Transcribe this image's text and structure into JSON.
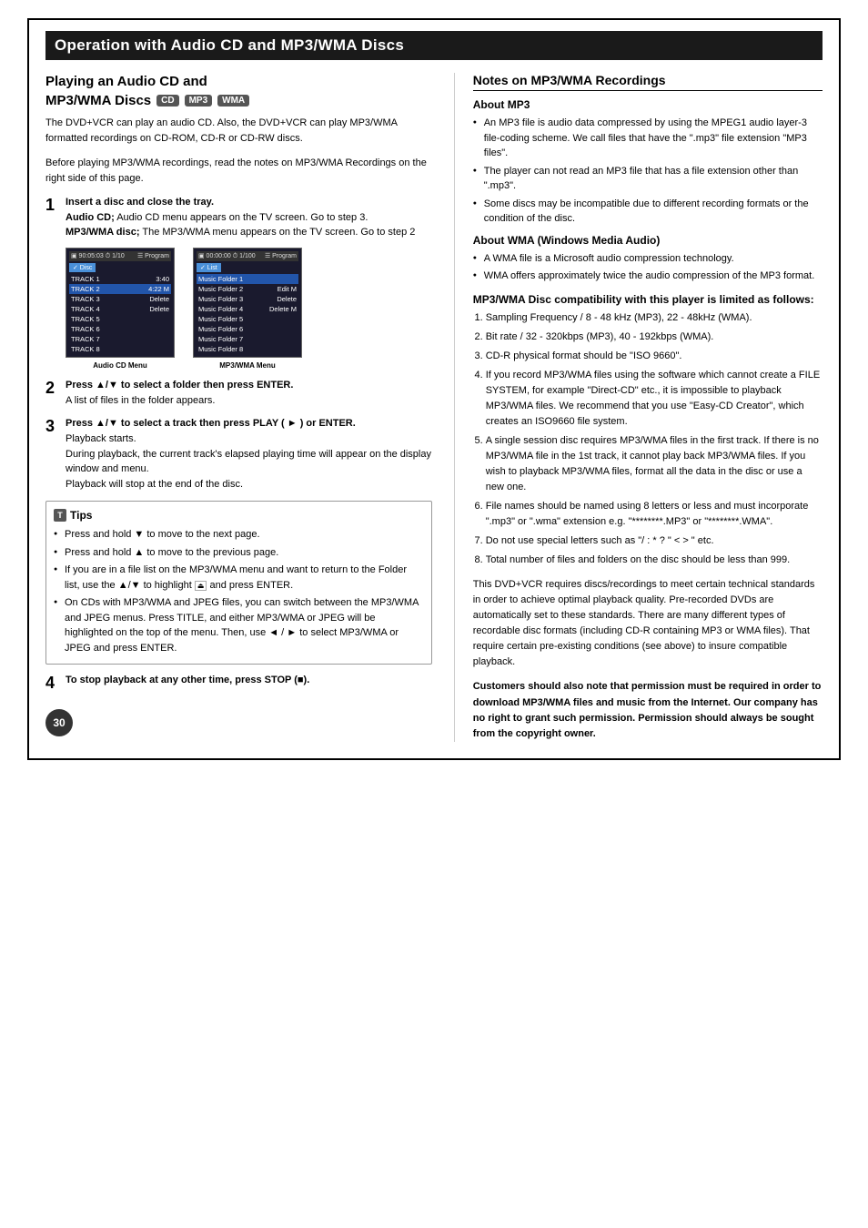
{
  "page": {
    "title": "Operation with Audio CD and MP3/WMA Discs",
    "page_number": "30",
    "left": {
      "section_title_line1": "Playing an Audio CD and",
      "section_title_line2": "MP3/WMA Discs",
      "badges": [
        "CD",
        "MP3",
        "WMA"
      ],
      "intro_paragraphs": [
        "The DVD+VCR can play an audio CD. Also, the DVD+VCR can play MP3/WMA formatted recordings on CD-ROM, CD-R or CD-RW discs.",
        "Before playing MP3/WMA recordings, read the notes on MP3/WMA Recordings on the right side of this page."
      ],
      "steps": [
        {
          "num": "1",
          "title": "Insert a disc and close the tray.",
          "body": "Audio CD; Audio CD menu appears on the TV screen. Go to step 3.\nMP3/WMA disc; The MP3/WMA menu appears on the TV screen. Go to step 2"
        },
        {
          "num": "2",
          "title": "Press ▲/▼ to select a folder then press ENTER.",
          "body": "A list of files in the folder appears."
        },
        {
          "num": "3",
          "title": "Press ▲/▼ to select a track then press PLAY ( ► ) or ENTER.",
          "body": "Playback starts.\nDuring playback, the current track's elapsed playing time will appear on the display window and menu.\nPlayback will stop at the end of the disc."
        }
      ],
      "menu_labels": [
        "Audio CD Menu",
        "MP3/WMA Menu"
      ],
      "audio_cd_menu": {
        "header_left": "90:05:03  ⏱ 1/10",
        "header_right": "Program",
        "tab_left": "Disc",
        "rows": [
          {
            "label": "TRACK 1",
            "time": "3:40"
          },
          {
            "label": "TRACK 2",
            "time": "4:22 M"
          },
          {
            "label": "TRACK 3",
            "time": "Delete"
          },
          {
            "label": "TRACK 4",
            "time": "Delete"
          },
          {
            "label": "TRACK 5",
            "time": ""
          },
          {
            "label": "TRACK 6",
            "time": ""
          },
          {
            "label": "TRACK 7",
            "time": ""
          },
          {
            "label": "TRACK 8",
            "time": ""
          }
        ]
      },
      "mp3_wma_menu": {
        "header_left": "00:00:00  ⏱ 1 / 100",
        "header_right": "Program",
        "tab_left": "List",
        "rows": [
          {
            "label": "Music Folder 1",
            "time": ""
          },
          {
            "label": "Music Folder 2",
            "time": "Edit M"
          },
          {
            "label": "Music Folder 3",
            "time": "Delete"
          },
          {
            "label": "Music Folder 4",
            "time": ""
          },
          {
            "label": "Music Folder 5",
            "time": ""
          },
          {
            "label": "Music Folder 6",
            "time": ""
          },
          {
            "label": "Music Folder 7",
            "time": ""
          },
          {
            "label": "Music Folder 8",
            "time": ""
          }
        ]
      },
      "tips": {
        "icon": "T",
        "title": "Tips",
        "items": [
          "Press and hold ▼ to move to the next page.",
          "Press and hold ▲ to move to the previous page.",
          "If you are in a file list on the MP3/WMA menu and want to return to the Folder list, use the ▲/▼ to highlight  and press ENTER.",
          "On CDs with MP3/WMA and JPEG files, you can switch between the MP3/WMA and JPEG menus. Press TITLE, and either MP3/WMA or JPEG will be highlighted on the top of the menu. Then, use ◄ / ► to select MP3/WMA or JPEG and press ENTER."
        ]
      },
      "step4": {
        "num": "4",
        "title": "To stop playback at any other time, press STOP (■)."
      }
    },
    "right": {
      "section_title": "Notes on MP3/WMA Recordings",
      "about_mp3_title": "About MP3",
      "about_mp3_items": [
        "An MP3 file is audio data compressed by using the MPEG1 audio layer-3 file-coding scheme. We call files that have the \".mp3\" file extension \"MP3 files\".",
        "The player can not read an MP3 file that has a file extension other than \".mp3\".",
        "Some discs may be incompatible due to different recording formats or the condition of the disc."
      ],
      "about_wma_title": "About WMA (Windows Media Audio)",
      "about_wma_items": [
        "A WMA file is a Microsoft audio compression technology.",
        "WMA offers approximately twice the audio compression of the MP3 format."
      ],
      "compat_title": "MP3/WMA Disc compatibility with this player is limited as follows:",
      "compat_items": [
        "Sampling Frequency / 8 - 48 kHz (MP3), 22 - 48kHz (WMA).",
        "Bit rate / 32 - 320kbps (MP3), 40 - 192kbps (WMA).",
        "CD-R physical format should be \"ISO 9660\".",
        "If you record MP3/WMA files using the software which cannot create a FILE SYSTEM, for example \"Direct-CD\" etc., it is impossible to playback MP3/WMA files. We recommend that you use \"Easy-CD Creator\", which creates an ISO9660 file system.",
        "A single session disc requires MP3/WMA files in the first track. If there is no MP3/WMA file in the 1st track, it cannot play back MP3/WMA files. If you wish to playback MP3/WMA files, format all the data in the disc or use a new one.",
        "File names should be named using 8 letters or less and must incorporate \".mp3\" or \".wma\" extension e.g. \"********.MP3\" or \"********.WMA\".",
        "Do not use special letters such as \"/ : * ? \" < > \" etc.",
        "Total number of files and folders on the disc should be less than 999."
      ],
      "footer_text": "This DVD+VCR requires discs/recordings to meet certain technical standards in order to achieve optimal playback quality. Pre-recorded DVDs are automatically set to these standards. There are many different types of recordable disc formats (including CD-R containing MP3 or WMA files). That require certain pre-existing conditions (see above) to insure compatible playback.",
      "footer_bold": "Customers should also note that permission must be required in order to download MP3/WMA files and music from the Internet. Our company has no right to grant such permission. Permission should always be sought from the copyright owner."
    }
  }
}
